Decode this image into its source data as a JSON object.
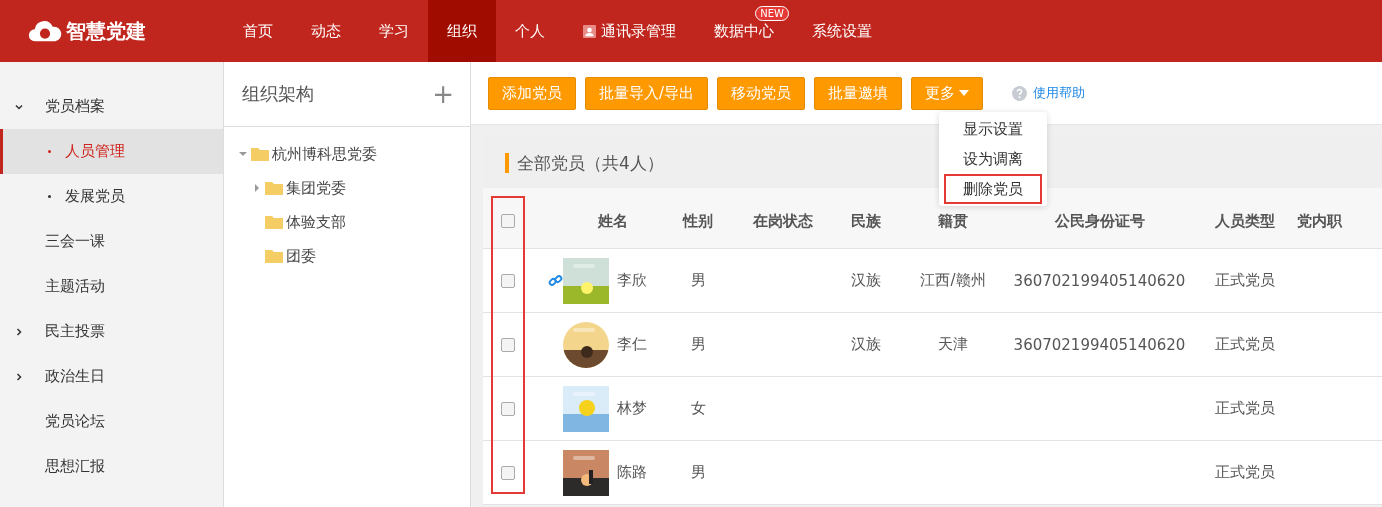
{
  "header": {
    "logo": "智慧党建",
    "nav": [
      {
        "label": "首页",
        "selected": false
      },
      {
        "label": "动态",
        "selected": false
      },
      {
        "label": "学习",
        "selected": false
      },
      {
        "label": "组织",
        "selected": true
      },
      {
        "label": "个人",
        "selected": false
      },
      {
        "label": "通讯录管理",
        "selected": false,
        "icon": true
      },
      {
        "label": "数据中心",
        "selected": false,
        "badge": "NEW"
      },
      {
        "label": "系统设置",
        "selected": false
      }
    ]
  },
  "sidebar": {
    "items": [
      {
        "label": "党员档案",
        "selected": false,
        "expanded": true,
        "children": [
          {
            "label": "人员管理",
            "selected": true
          },
          {
            "label": "发展党员",
            "selected": false
          }
        ]
      },
      {
        "label": "三会一课",
        "selected": false
      },
      {
        "label": "主题活动",
        "selected": false
      },
      {
        "label": "民主投票",
        "selected": false,
        "expanded": false
      },
      {
        "label": "政治生日",
        "selected": false,
        "expanded": false
      },
      {
        "label": "党员论坛",
        "selected": false
      },
      {
        "label": "思想汇报",
        "selected": false
      }
    ]
  },
  "org_tree": {
    "title": "组织架构",
    "add": "+",
    "nodes": [
      {
        "label": "杭州博科思党委",
        "expanded": true,
        "children": [
          {
            "label": "集团党委",
            "expanded": false
          },
          {
            "label": "体验支部"
          },
          {
            "label": "团委"
          }
        ]
      }
    ]
  },
  "toolbar": {
    "buttons": [
      {
        "label": "添加党员",
        "kind": "button"
      },
      {
        "label": "批量导入/导出",
        "kind": "button"
      },
      {
        "label": "移动党员",
        "kind": "button"
      },
      {
        "label": "批量邀填",
        "kind": "button"
      },
      {
        "label": "更多",
        "kind": "dropdown"
      }
    ],
    "help": "使用帮助"
  },
  "more_menu": {
    "items": [
      {
        "label": "显示设置",
        "highlighted": false
      },
      {
        "label": "设为调离",
        "highlighted": false
      },
      {
        "label": "删除党员",
        "highlighted": true
      }
    ]
  },
  "table": {
    "title": "全部党员（共4人）",
    "checkbox_column_highlighted": true,
    "select_all": {
      "checked": false
    },
    "columns": [
      "姓名",
      "性别",
      "在岗状态",
      "民族",
      "籍贯",
      "公民身份证号",
      "人员类型",
      "党内职"
    ],
    "rows": [
      {
        "checked": false,
        "linked": true,
        "avatar": {
          "round": false
        },
        "name": "李欣",
        "gender": "男",
        "ethnic": "汉族",
        "native": "江西/赣州",
        "id_number": "360702199405140620",
        "type": "正式党员"
      },
      {
        "checked": false,
        "linked": false,
        "avatar": {
          "round": true
        },
        "name": "李仁",
        "gender": "男",
        "ethnic": "汉族",
        "native": "天津",
        "id_number": "360702199405140620",
        "type": "正式党员"
      },
      {
        "checked": false,
        "linked": false,
        "avatar": {
          "round": false
        },
        "name": "林梦",
        "gender": "女",
        "type": "正式党员"
      },
      {
        "checked": false,
        "linked": false,
        "avatar": {
          "round": false
        },
        "name": "陈路",
        "gender": "男",
        "type": "正式党员"
      }
    ]
  }
}
